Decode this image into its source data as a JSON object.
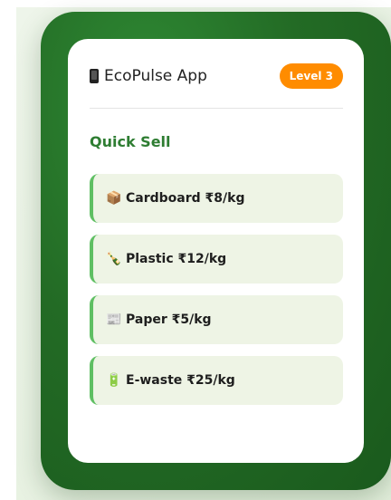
{
  "header": {
    "title": "EcoPulse App",
    "level_badge": "Level 3",
    "title_icon": "mobile-phone-icon"
  },
  "quick_sell": {
    "title": "Quick Sell",
    "items": [
      {
        "emoji": "📦",
        "label": "Cardboard ₹8/kg",
        "icon": "box-icon"
      },
      {
        "emoji": "🍾",
        "label": "Plastic ₹12/kg",
        "icon": "bottle-icon"
      },
      {
        "emoji": "📰",
        "label": "Paper ₹5/kg",
        "icon": "newspaper-icon"
      },
      {
        "emoji": "🔋",
        "label": "E-waste ₹25/kg",
        "icon": "battery-icon"
      }
    ]
  },
  "colors": {
    "accent_green": "#2e7d32",
    "badge_orange": "#ff8c00",
    "item_bg": "#eef4e5",
    "item_border": "#5fbf63"
  }
}
